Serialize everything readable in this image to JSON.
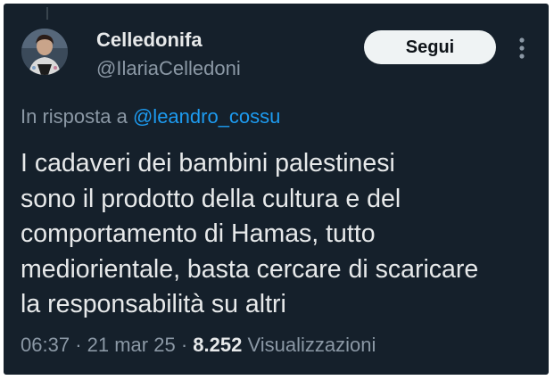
{
  "tweet": {
    "author": {
      "display_name": "Celledonifa",
      "handle": "@IlariaCelledoni"
    },
    "follow_label": "Segui",
    "more_icon": "more-vertical-icon",
    "reply_prefix": "In risposta a",
    "reply_handle": "@leandro_cossu",
    "text_lines": [
      "I cadaveri dei bambini palestinesi",
      "sono il prodotto della cultura e del",
      "comportamento di Hamas, tutto",
      "mediorientale, basta cercare di scaricare",
      "la responsabilità su altri"
    ],
    "time": "06:37",
    "date": "21 mar 25",
    "separator": "·",
    "views_count": "8.252",
    "views_label": "Visualizzazioni"
  },
  "colors": {
    "background": "#15202b",
    "primary_text": "#e7e9ea",
    "secondary_text": "#8b98a5",
    "link": "#1d9bf0",
    "button_bg": "#eff3f4"
  }
}
